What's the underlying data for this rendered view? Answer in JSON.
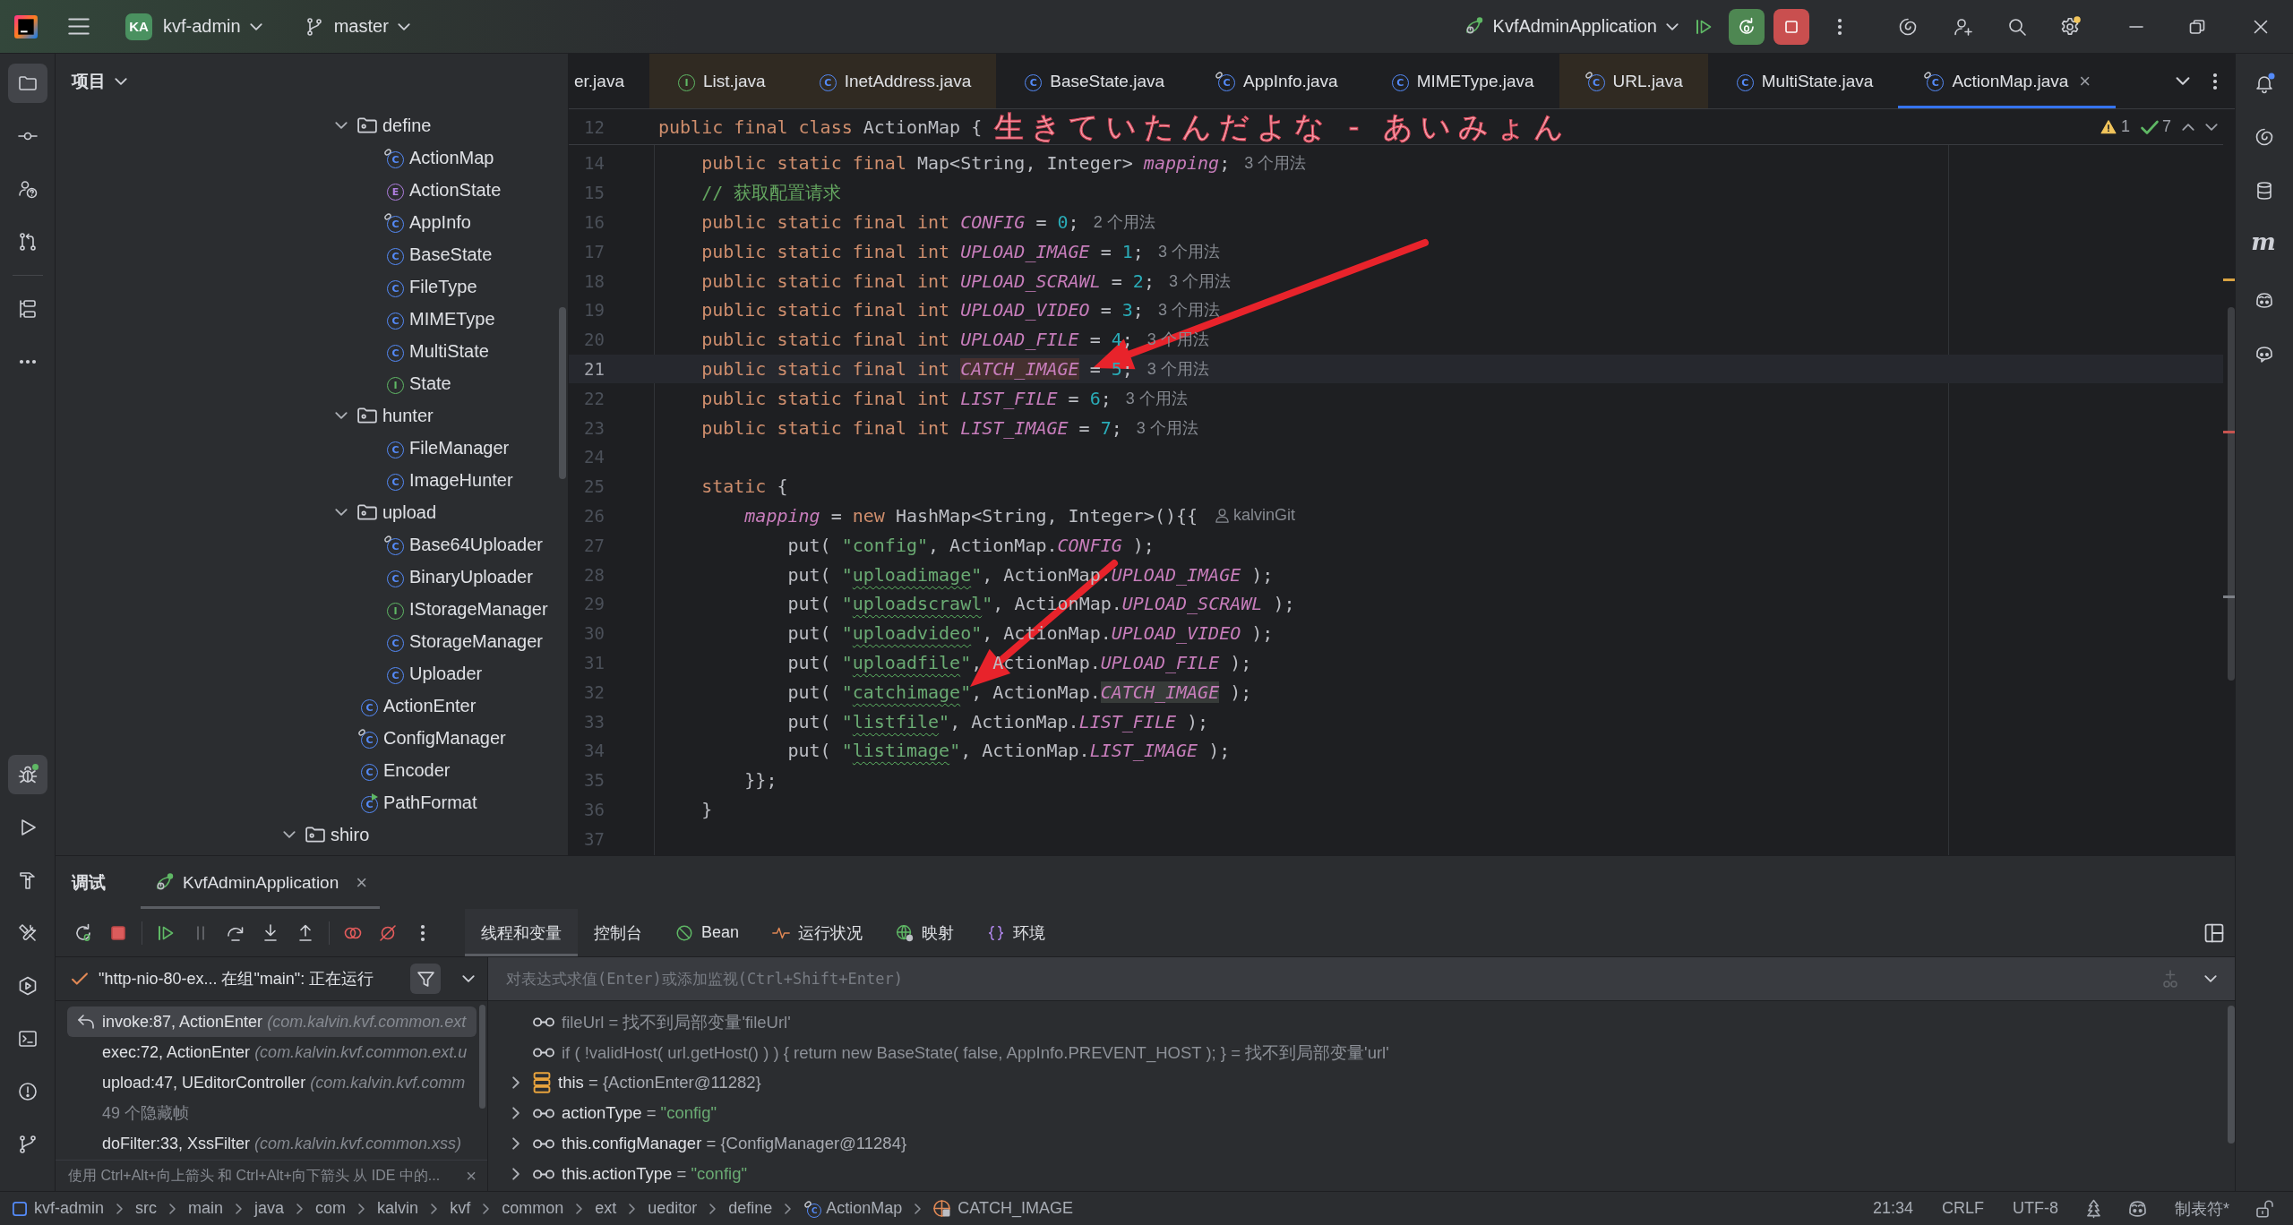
{
  "title_bar": {
    "project_badge": "KA",
    "project": "kvf-admin",
    "branch": "master",
    "run_config": "KvfAdminApplication",
    "settings_badge": true
  },
  "left_toolbar": {
    "top": [
      {
        "kind": "project",
        "selected": true
      },
      {
        "kind": "commit",
        "selected": false
      },
      {
        "kind": "chat",
        "selected": false
      },
      {
        "kind": "pull_requests",
        "selected": false
      },
      {
        "kind": "separator"
      },
      {
        "kind": "structure",
        "selected": false
      },
      {
        "kind": "more",
        "selected": false
      }
    ],
    "bottom": [
      {
        "kind": "debug",
        "selected": true,
        "running": true
      },
      {
        "kind": "run",
        "selected": false,
        "running": false
      },
      {
        "kind": "build",
        "selected": false,
        "running": false
      },
      {
        "kind": "tools",
        "selected": false,
        "running": false
      },
      {
        "kind": "services",
        "selected": false,
        "running": false
      },
      {
        "kind": "terminal",
        "selected": false,
        "running": false
      },
      {
        "kind": "problems",
        "selected": false,
        "running": false
      },
      {
        "kind": "git",
        "selected": false,
        "running": false
      }
    ]
  },
  "right_toolbar": [
    {
      "kind": "notifications",
      "badge": true
    },
    {
      "kind": "ai_assistant",
      "badge": false
    },
    {
      "kind": "database",
      "badge": false
    },
    {
      "kind": "maven",
      "glyph": "m",
      "badge": false
    },
    {
      "kind": "copilot",
      "badge": false
    },
    {
      "kind": "copilot_chat",
      "badge": false
    }
  ],
  "project_panel": {
    "title": "项目",
    "tree": [
      {
        "children": [
          {
            "children": [
              {
                "label": "define",
                "kind": "folder",
                "expanded": true,
                "children": [
                  {
                    "label": "ActionMap",
                    "kind": "class_linked",
                    "type_letter": "C"
                  },
                  {
                    "label": "ActionState",
                    "kind": "enum",
                    "type_letter": "E"
                  },
                  {
                    "label": "AppInfo",
                    "kind": "class_linked",
                    "type_letter": "C"
                  },
                  {
                    "label": "BaseState",
                    "kind": "class",
                    "type_letter": "C"
                  },
                  {
                    "label": "FileType",
                    "kind": "class",
                    "type_letter": "C"
                  },
                  {
                    "label": "MIMEType",
                    "kind": "class",
                    "type_letter": "C"
                  },
                  {
                    "label": "MultiState",
                    "kind": "class",
                    "type_letter": "C"
                  },
                  {
                    "label": "State",
                    "kind": "interface",
                    "type_letter": "I"
                  }
                ]
              },
              {
                "label": "hunter",
                "kind": "folder",
                "expanded": true,
                "children": [
                  {
                    "label": "FileManager",
                    "kind": "class",
                    "type_letter": "C"
                  },
                  {
                    "label": "ImageHunter",
                    "kind": "class",
                    "type_letter": "C"
                  }
                ]
              },
              {
                "label": "upload",
                "kind": "folder",
                "expanded": true,
                "children": [
                  {
                    "label": "Base64Uploader",
                    "kind": "class_linked",
                    "type_letter": "C"
                  },
                  {
                    "label": "BinaryUploader",
                    "kind": "class",
                    "type_letter": "C"
                  },
                  {
                    "label": "IStorageManager",
                    "kind": "interface",
                    "type_letter": "I"
                  },
                  {
                    "label": "StorageManager",
                    "kind": "class",
                    "type_letter": "C"
                  },
                  {
                    "label": "Uploader",
                    "kind": "class",
                    "type_letter": "C"
                  }
                ]
              },
              {
                "label": "ActionEnter",
                "kind": "class",
                "type_letter": "C"
              },
              {
                "label": "ConfigManager",
                "kind": "class_linked",
                "type_letter": "C"
              },
              {
                "label": "Encoder",
                "kind": "class",
                "type_letter": "C"
              },
              {
                "label": "PathFormat",
                "kind": "class_runnable",
                "type_letter": "C"
              }
            ]
          }
        ]
      },
      {
        "label": "shiro",
        "kind": "folder",
        "expanded": true
      }
    ]
  },
  "editor": {
    "tabs": [
      {
        "label": "er.java",
        "selected": false,
        "external": false
      },
      {
        "label": "List.java",
        "kind": "interface",
        "type_letter": "I",
        "selected": false,
        "external": true
      },
      {
        "label": "InetAddress.java",
        "kind": "class",
        "type_letter": "C",
        "selected": false,
        "external": true
      },
      {
        "label": "BaseState.java",
        "kind": "class",
        "type_letter": "C",
        "selected": false,
        "external": false
      },
      {
        "label": "AppInfo.java",
        "kind": "class_linked",
        "type_letter": "C",
        "selected": false,
        "external": false
      },
      {
        "label": "MIMEType.java",
        "kind": "class",
        "type_letter": "C",
        "selected": false,
        "external": false
      },
      {
        "label": "URL.java",
        "kind": "class_linked",
        "type_letter": "C",
        "selected": false,
        "external": true
      },
      {
        "label": "MultiState.java",
        "kind": "class",
        "type_letter": "C",
        "selected": false,
        "external": false
      },
      {
        "label": "ActionMap.java",
        "kind": "class_linked",
        "type_letter": "C",
        "selected": true,
        "external": false,
        "close": "×"
      }
    ],
    "inspections": {
      "warnings": "1",
      "typos": "7"
    },
    "sticky_line": {
      "number": "12",
      "tokens": [
        {
          "kind": "keyword",
          "text": "public final class "
        },
        {
          "kind": "plain",
          "text": "ActionMap {"
        }
      ]
    },
    "lines": [
      {
        "number": "14",
        "current": false,
        "tokens": [
          {
            "kind": "keyword",
            "text": "    public static final "
          },
          {
            "kind": "plain",
            "text": "Map<String, Integer> "
          },
          {
            "kind": "field",
            "text": "mapping"
          },
          {
            "kind": "plain",
            "text": ";"
          }
        ],
        "hint": "3 个用法"
      },
      {
        "number": "15",
        "current": false,
        "tokens": [
          {
            "kind": "comment",
            "text": "    // 获取配置请求"
          }
        ]
      },
      {
        "number": "16",
        "current": false,
        "tokens": [
          {
            "kind": "keyword",
            "text": "    public static final int "
          },
          {
            "kind": "field",
            "text": "CONFIG"
          },
          {
            "kind": "plain",
            "text": " = "
          },
          {
            "kind": "number",
            "text": "0"
          },
          {
            "kind": "plain",
            "text": ";"
          }
        ],
        "hint": "2 个用法"
      },
      {
        "number": "17",
        "current": false,
        "tokens": [
          {
            "kind": "keyword",
            "text": "    public static final int "
          },
          {
            "kind": "field",
            "text": "UPLOAD_IMAGE"
          },
          {
            "kind": "plain",
            "text": " = "
          },
          {
            "kind": "number",
            "text": "1"
          },
          {
            "kind": "plain",
            "text": ";"
          }
        ],
        "hint": "3 个用法"
      },
      {
        "number": "18",
        "current": false,
        "tokens": [
          {
            "kind": "keyword",
            "text": "    public static final int "
          },
          {
            "kind": "field",
            "text": "UPLOAD_SCRAWL"
          },
          {
            "kind": "plain",
            "text": " = "
          },
          {
            "kind": "number",
            "text": "2"
          },
          {
            "kind": "plain",
            "text": ";"
          }
        ],
        "hint": "3 个用法"
      },
      {
        "number": "19",
        "current": false,
        "tokens": [
          {
            "kind": "keyword",
            "text": "    public static final int "
          },
          {
            "kind": "field",
            "text": "UPLOAD_VIDEO"
          },
          {
            "kind": "plain",
            "text": " = "
          },
          {
            "kind": "number",
            "text": "3"
          },
          {
            "kind": "plain",
            "text": ";"
          }
        ],
        "hint": "3 个用法"
      },
      {
        "number": "20",
        "current": false,
        "tokens": [
          {
            "kind": "keyword",
            "text": "    public static final int "
          },
          {
            "kind": "field",
            "text": "UPLOAD_FILE"
          },
          {
            "kind": "plain",
            "text": " = "
          },
          {
            "kind": "number",
            "text": "4"
          },
          {
            "kind": "plain",
            "text": ";"
          }
        ],
        "hint": "3 个用法"
      },
      {
        "number": "21",
        "current": true,
        "tokens": [
          {
            "kind": "keyword",
            "text": "    public static final int "
          },
          {
            "kind": "field_write_highlight",
            "text": "CATCH_IMAGE"
          },
          {
            "kind": "plain",
            "text": " = "
          },
          {
            "kind": "number",
            "text": "5"
          },
          {
            "kind": "plain",
            "text": ";"
          }
        ],
        "hint": "3 个用法"
      },
      {
        "number": "22",
        "current": false,
        "tokens": [
          {
            "kind": "keyword",
            "text": "    public static final int "
          },
          {
            "kind": "field",
            "text": "LIST_FILE"
          },
          {
            "kind": "plain",
            "text": " = "
          },
          {
            "kind": "number",
            "text": "6"
          },
          {
            "kind": "plain",
            "text": ";"
          }
        ],
        "hint": "3 个用法"
      },
      {
        "number": "23",
        "current": false,
        "tokens": [
          {
            "kind": "keyword",
            "text": "    public static final int "
          },
          {
            "kind": "field",
            "text": "LIST_IMAGE"
          },
          {
            "kind": "plain",
            "text": " = "
          },
          {
            "kind": "number",
            "text": "7"
          },
          {
            "kind": "plain",
            "text": ";"
          }
        ],
        "hint": "3 个用法"
      },
      {
        "number": "24",
        "current": false
      },
      {
        "number": "25",
        "current": false,
        "tokens": [
          {
            "kind": "keyword",
            "text": "    static"
          },
          {
            "kind": "plain",
            "text": " {"
          }
        ]
      },
      {
        "number": "26",
        "current": false,
        "tokens": [
          {
            "kind": "field",
            "text": "        mapping"
          },
          {
            "kind": "plain",
            "text": " = "
          },
          {
            "kind": "keyword",
            "text": "new"
          },
          {
            "kind": "plain",
            "text": " HashMap<String, Integer>(){{"
          }
        ],
        "author": "kalvinGit"
      },
      {
        "number": "27",
        "current": false,
        "tokens": [
          {
            "kind": "plain",
            "text": "            put( "
          },
          {
            "kind": "string",
            "text": "\"config\""
          },
          {
            "kind": "plain",
            "text": ", ActionMap."
          },
          {
            "kind": "field",
            "text": "CONFIG"
          },
          {
            "kind": "plain",
            "text": " );"
          }
        ]
      },
      {
        "number": "28",
        "current": false,
        "tokens": [
          {
            "kind": "plain",
            "text": "            put( "
          },
          {
            "kind": "string",
            "text": "\""
          },
          {
            "kind": "string",
            "text": "uploadimage",
            "typo": true
          },
          {
            "kind": "string",
            "text": "\""
          },
          {
            "kind": "plain",
            "text": ", ActionMap."
          },
          {
            "kind": "field",
            "text": "UPLOAD_IMAGE"
          },
          {
            "kind": "plain",
            "text": " );"
          }
        ]
      },
      {
        "number": "29",
        "current": false,
        "tokens": [
          {
            "kind": "plain",
            "text": "            put( "
          },
          {
            "kind": "string",
            "text": "\""
          },
          {
            "kind": "string",
            "text": "uploadscrawl",
            "typo": true
          },
          {
            "kind": "string",
            "text": "\""
          },
          {
            "kind": "plain",
            "text": ", ActionMap."
          },
          {
            "kind": "field",
            "text": "UPLOAD_SCRAWL"
          },
          {
            "kind": "plain",
            "text": " );"
          }
        ]
      },
      {
        "number": "30",
        "current": false,
        "tokens": [
          {
            "kind": "plain",
            "text": "            put( "
          },
          {
            "kind": "string",
            "text": "\""
          },
          {
            "kind": "string",
            "text": "uploadvideo",
            "typo": true
          },
          {
            "kind": "string",
            "text": "\""
          },
          {
            "kind": "plain",
            "text": ", ActionMap."
          },
          {
            "kind": "field",
            "text": "UPLOAD_VIDEO"
          },
          {
            "kind": "plain",
            "text": " );"
          }
        ]
      },
      {
        "number": "31",
        "current": false,
        "tokens": [
          {
            "kind": "plain",
            "text": "            put( "
          },
          {
            "kind": "string",
            "text": "\""
          },
          {
            "kind": "string",
            "text": "uploadfile",
            "typo": true
          },
          {
            "kind": "string",
            "text": "\""
          },
          {
            "kind": "plain",
            "text": ", ActionMap."
          },
          {
            "kind": "field",
            "text": "UPLOAD_FILE"
          },
          {
            "kind": "plain",
            "text": " );"
          }
        ]
      },
      {
        "number": "32",
        "current": false,
        "tokens": [
          {
            "kind": "plain",
            "text": "            put( "
          },
          {
            "kind": "string",
            "text": "\""
          },
          {
            "kind": "string",
            "text": "catchimage",
            "typo": true
          },
          {
            "kind": "string",
            "text": "\""
          },
          {
            "kind": "plain",
            "text": ", ActionMap."
          },
          {
            "kind": "field_read_highlight",
            "text": "CATCH_IMAGE"
          },
          {
            "kind": "plain",
            "text": " );"
          }
        ]
      },
      {
        "number": "33",
        "current": false,
        "tokens": [
          {
            "kind": "plain",
            "text": "            put( "
          },
          {
            "kind": "string",
            "text": "\""
          },
          {
            "kind": "string",
            "text": "listfile",
            "typo": true
          },
          {
            "kind": "string",
            "text": "\""
          },
          {
            "kind": "plain",
            "text": ", ActionMap."
          },
          {
            "kind": "field",
            "text": "LIST_FILE"
          },
          {
            "kind": "plain",
            "text": " );"
          }
        ]
      },
      {
        "number": "34",
        "current": false,
        "tokens": [
          {
            "kind": "plain",
            "text": "            put( "
          },
          {
            "kind": "string",
            "text": "\""
          },
          {
            "kind": "string",
            "text": "listimage",
            "typo": true
          },
          {
            "kind": "string",
            "text": "\""
          },
          {
            "kind": "plain",
            "text": ", ActionMap."
          },
          {
            "kind": "field",
            "text": "LIST_IMAGE"
          },
          {
            "kind": "plain",
            "text": " );"
          }
        ]
      },
      {
        "number": "35",
        "current": false,
        "tokens": [
          {
            "kind": "plain",
            "text": "        }};"
          }
        ]
      },
      {
        "number": "36",
        "current": false,
        "tokens": [
          {
            "kind": "plain",
            "text": "    }"
          }
        ]
      },
      {
        "number": "37",
        "current": false
      }
    ]
  },
  "debug_panel": {
    "title": "调试",
    "session_tabs": [
      {
        "label": "KvfAdminApplication",
        "selected": true,
        "close": "×"
      }
    ],
    "toolbar": [
      {
        "kind": "rerun",
        "disabled": false
      },
      {
        "kind": "stop",
        "disabled": false
      },
      {
        "kind": "separator"
      },
      {
        "kind": "resume",
        "disabled": false
      },
      {
        "kind": "pause",
        "disabled": true
      },
      {
        "kind": "step_over",
        "disabled": false
      },
      {
        "kind": "step_into",
        "disabled": false
      },
      {
        "kind": "step_out",
        "disabled": false
      },
      {
        "kind": "separator"
      },
      {
        "kind": "breakpoints",
        "disabled": false
      },
      {
        "kind": "mute_breakpoints",
        "disabled": false
      },
      {
        "kind": "more",
        "disabled": false
      }
    ],
    "view_tabs": [
      {
        "label": "线程和变量",
        "selected": true,
        "kind": "text"
      },
      {
        "label": "控制台",
        "selected": false,
        "kind": "text"
      },
      {
        "label": "Bean",
        "selected": false,
        "kind": "bean"
      },
      {
        "label": "运行状况",
        "selected": false,
        "kind": "health"
      },
      {
        "label": "映射",
        "selected": false,
        "kind": "mapping"
      },
      {
        "label": "环境",
        "selected": false,
        "kind": "environment"
      }
    ],
    "thread": {
      "label": "\"http-nio-80-ex... 在组\"main\": 正在运行"
    },
    "evaluate_field": {
      "placeholder": "对表达式求值(Enter)或添加监视(Ctrl+Shift+Enter)"
    },
    "frames": [
      {
        "kind": "frame",
        "method": "invoke:87, ActionEnter",
        "location": "(com.kalvin.kvf.common.ext",
        "selected": true,
        "current": true
      },
      {
        "kind": "frame",
        "method": "exec:72, ActionEnter",
        "location": "(com.kalvin.kvf.common.ext.u",
        "selected": false,
        "current": false
      },
      {
        "kind": "frame",
        "method": "upload:47, UEditorController",
        "location": "(com.kalvin.kvf.comm",
        "selected": false,
        "current": false
      },
      {
        "kind": "hidden",
        "label": "49 个隐藏帧",
        "selected": false
      },
      {
        "kind": "frame",
        "method": "doFilter:33, XssFilter",
        "location": "(com.kalvin.kvf.common.xss)",
        "selected": false,
        "current": false
      }
    ],
    "hint": {
      "text": "使用 Ctrl+Alt+向上箭头 和 Ctrl+Alt+向下箭头 从 IDE 中的...",
      "close": "×"
    },
    "variables": [
      {
        "kind": "watch_error",
        "name": "fileUrl",
        "equals": "=",
        "value": "找不到局部变量'fileUrl'",
        "expandable": false
      },
      {
        "kind": "watch_error",
        "name": "if ( !validHost( url.getHost() ) ) { return new BaseState( false, AppInfo.PREVENT_HOST ); }",
        "equals": "=",
        "value": "找不到局部变量'url'",
        "expandable": false
      },
      {
        "kind": "object",
        "name": "this",
        "equals": "=",
        "value": "{ActionEnter@11282}",
        "expandable": true
      },
      {
        "kind": "watch_string",
        "name": "actionType",
        "equals": "=",
        "value": "\"config\"",
        "expandable": true
      },
      {
        "kind": "watch_object",
        "name": "this.configManager",
        "equals": "=",
        "value": "{ConfigManager@11284}",
        "expandable": true
      },
      {
        "kind": "watch_string",
        "name": "this.actionType",
        "equals": "=",
        "value": "\"config\"",
        "expandable": true
      }
    ]
  },
  "status_bar": {
    "breadcrumbs": [
      {
        "label": "kvf-admin",
        "kind": "module"
      },
      {
        "label": "src",
        "kind": "dir"
      },
      {
        "label": "main",
        "kind": "dir"
      },
      {
        "label": "java",
        "kind": "dir"
      },
      {
        "label": "com",
        "kind": "dir"
      },
      {
        "label": "kalvin",
        "kind": "dir"
      },
      {
        "label": "kvf",
        "kind": "dir"
      },
      {
        "label": "common",
        "kind": "dir"
      },
      {
        "label": "ext",
        "kind": "dir"
      },
      {
        "label": "ueditor",
        "kind": "dir"
      },
      {
        "label": "define",
        "kind": "dir"
      },
      {
        "label": "ActionMap",
        "kind": "class_linked",
        "type_letter": "C"
      },
      {
        "label": "CATCH_IMAGE",
        "kind": "field"
      }
    ],
    "caret": "21:34",
    "line_separator": "CRLF",
    "encoding": "UTF-8",
    "indent": "制表符*"
  },
  "desktop_lyrics": {
    "text": "生きていたんだよな - あいみょん"
  },
  "annotations": [
    {
      "kind": "arrow"
    },
    {
      "kind": "arrow"
    }
  ]
}
